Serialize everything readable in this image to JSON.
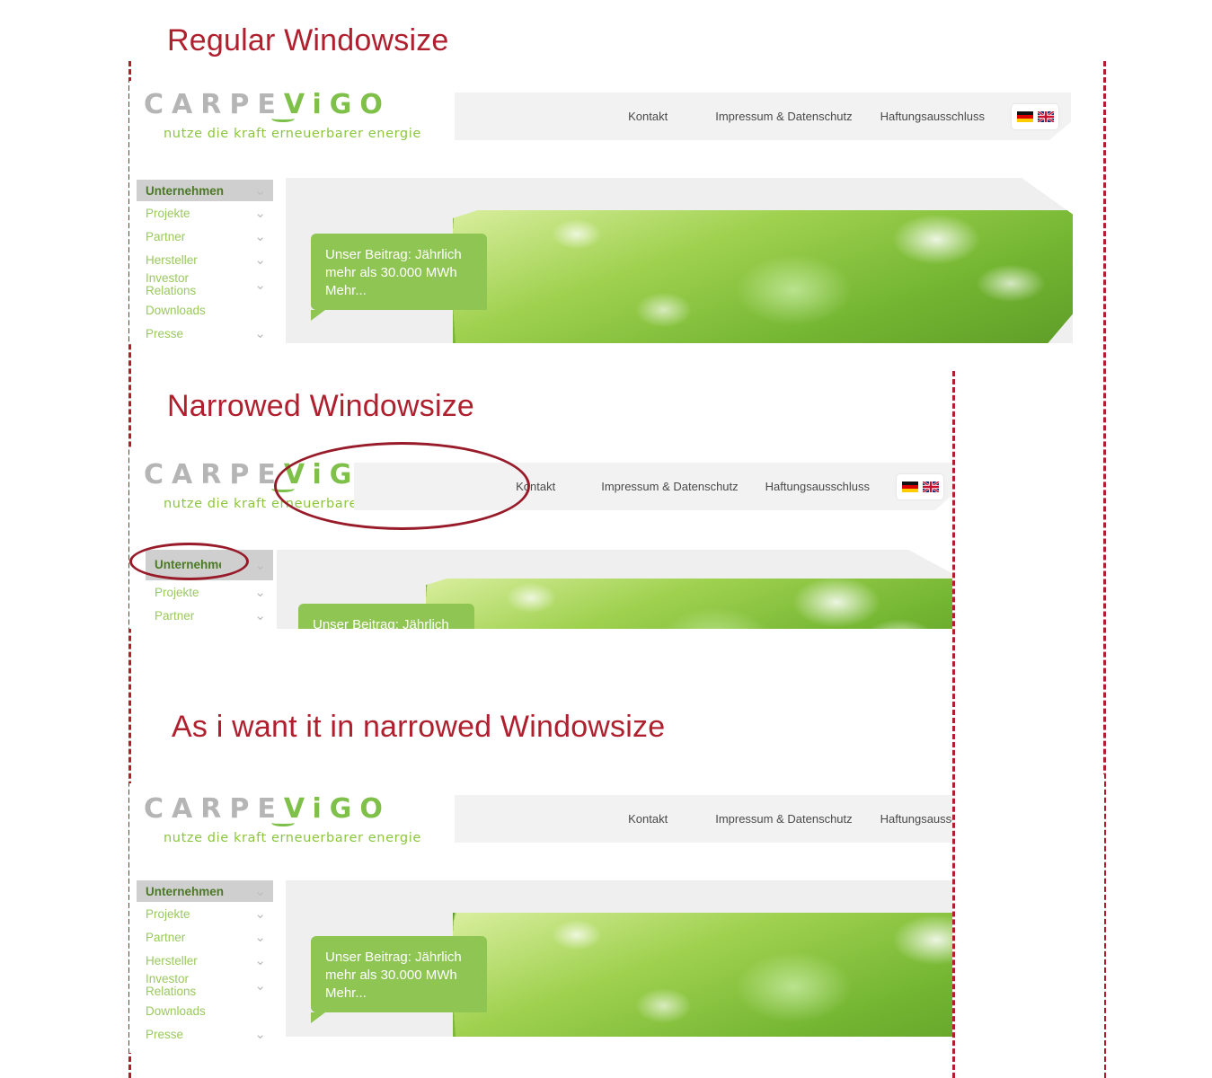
{
  "annotations": {
    "captions": [
      {
        "text": "Regular Windowsize"
      },
      {
        "text": "Narrowed Windowsize"
      },
      {
        "text": "As i want it in narrowed Windowsize"
      }
    ],
    "color": "#B01F2E",
    "ellipse_targets": [
      "logo-vigo-wordmark",
      "sidebar-item-unternehmen"
    ]
  },
  "site": {
    "logo": {
      "part_gray": "CARPE",
      "part_green": "ViGO",
      "tagline": "nutze die kraft erneuerbarer energie",
      "color_gray": "#b5b5b5",
      "color_green": "#7fc04b",
      "tagline_color": "#8cc63f"
    },
    "topnav": {
      "links": [
        "Kontakt",
        "Impressum & Datenschutz",
        "Haftungsausschluss"
      ],
      "languages": [
        "de-flag-icon",
        "en-flag-icon"
      ],
      "background": "#f2f2f2"
    },
    "sidebar": {
      "items": [
        {
          "label": "Unternehmen",
          "has_chevron": true,
          "active": true
        },
        {
          "label": "Projekte",
          "has_chevron": true,
          "active": false
        },
        {
          "label": "Partner",
          "has_chevron": true,
          "active": false
        },
        {
          "label": "Hersteller",
          "has_chevron": true,
          "active": false
        },
        {
          "label": "Investor Relations",
          "has_chevron": true,
          "active": false
        },
        {
          "label": "Downloads",
          "has_chevron": false,
          "active": false
        },
        {
          "label": "Presse",
          "has_chevron": true,
          "active": false
        }
      ],
      "active_bg": "#cfcfcf",
      "link_color": "#9ac95c",
      "active_color": "#4b7a24",
      "chevron_glyph": "⌄"
    },
    "hero": {
      "callout_line1": "Unser Beitrag: Jährlich",
      "callout_line2": "mehr als 30.000 MWh",
      "callout_more": "Mehr...",
      "callout_color": "#8fc553",
      "panel_color": "#efefef"
    }
  },
  "sections": {
    "narrowed_sidebar_first_label": "Unternehmen"
  }
}
